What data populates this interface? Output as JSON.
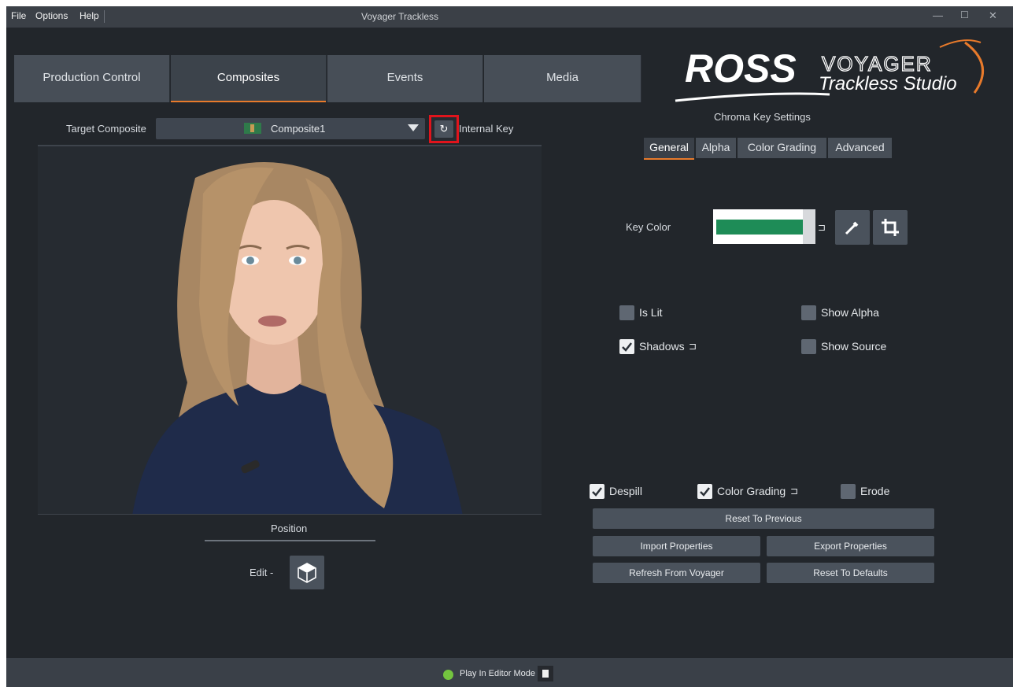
{
  "menu": {
    "file": "File",
    "options": "Options",
    "help": "Help"
  },
  "window": {
    "title": "Voyager Trackless",
    "minimize": "—",
    "maximize": "☐",
    "close": "✕"
  },
  "tabs": [
    {
      "label": "Production Control"
    },
    {
      "label": "Composites"
    },
    {
      "label": "Events"
    },
    {
      "label": "Media"
    }
  ],
  "logo": {
    "brand": "ROSS",
    "line1": "VOYAGER",
    "line2": "Trackless Studio"
  },
  "composite": {
    "target_label": "Target Composite",
    "selected": "Composite1",
    "internal_key_label": "Internal Key",
    "refresh_icon": "↻"
  },
  "position": {
    "label": "Position",
    "edit_label": "Edit -"
  },
  "chroma": {
    "title": "Chroma Key Settings",
    "subtabs": [
      {
        "label": "General"
      },
      {
        "label": "Alpha"
      },
      {
        "label": "Color Grading"
      },
      {
        "label": "Advanced"
      }
    ],
    "key_color_label": "Key Color",
    "key_color": "#1e8c57",
    "is_lit": {
      "label": "Is Lit",
      "checked": false
    },
    "show_alpha": {
      "label": "Show Alpha",
      "checked": false
    },
    "shadows": {
      "label": "Shadows",
      "checked": true
    },
    "show_source": {
      "label": "Show Source",
      "checked": false
    },
    "despill": {
      "label": "Despill",
      "checked": true
    },
    "color_grading": {
      "label": "Color Grading",
      "checked": true
    },
    "erode": {
      "label": "Erode",
      "checked": false
    },
    "buttons": {
      "reset_previous": "Reset To Previous",
      "import": "Import Properties",
      "export": "Export Properties",
      "refresh": "Refresh From Voyager",
      "reset_defaults": "Reset To Defaults"
    }
  },
  "status": {
    "mode_label": "Play In Editor Mode",
    "indicator_color": "#74c43f"
  },
  "colors": {
    "accent": "#e87a2b",
    "highlight_box": "#e0141c"
  }
}
